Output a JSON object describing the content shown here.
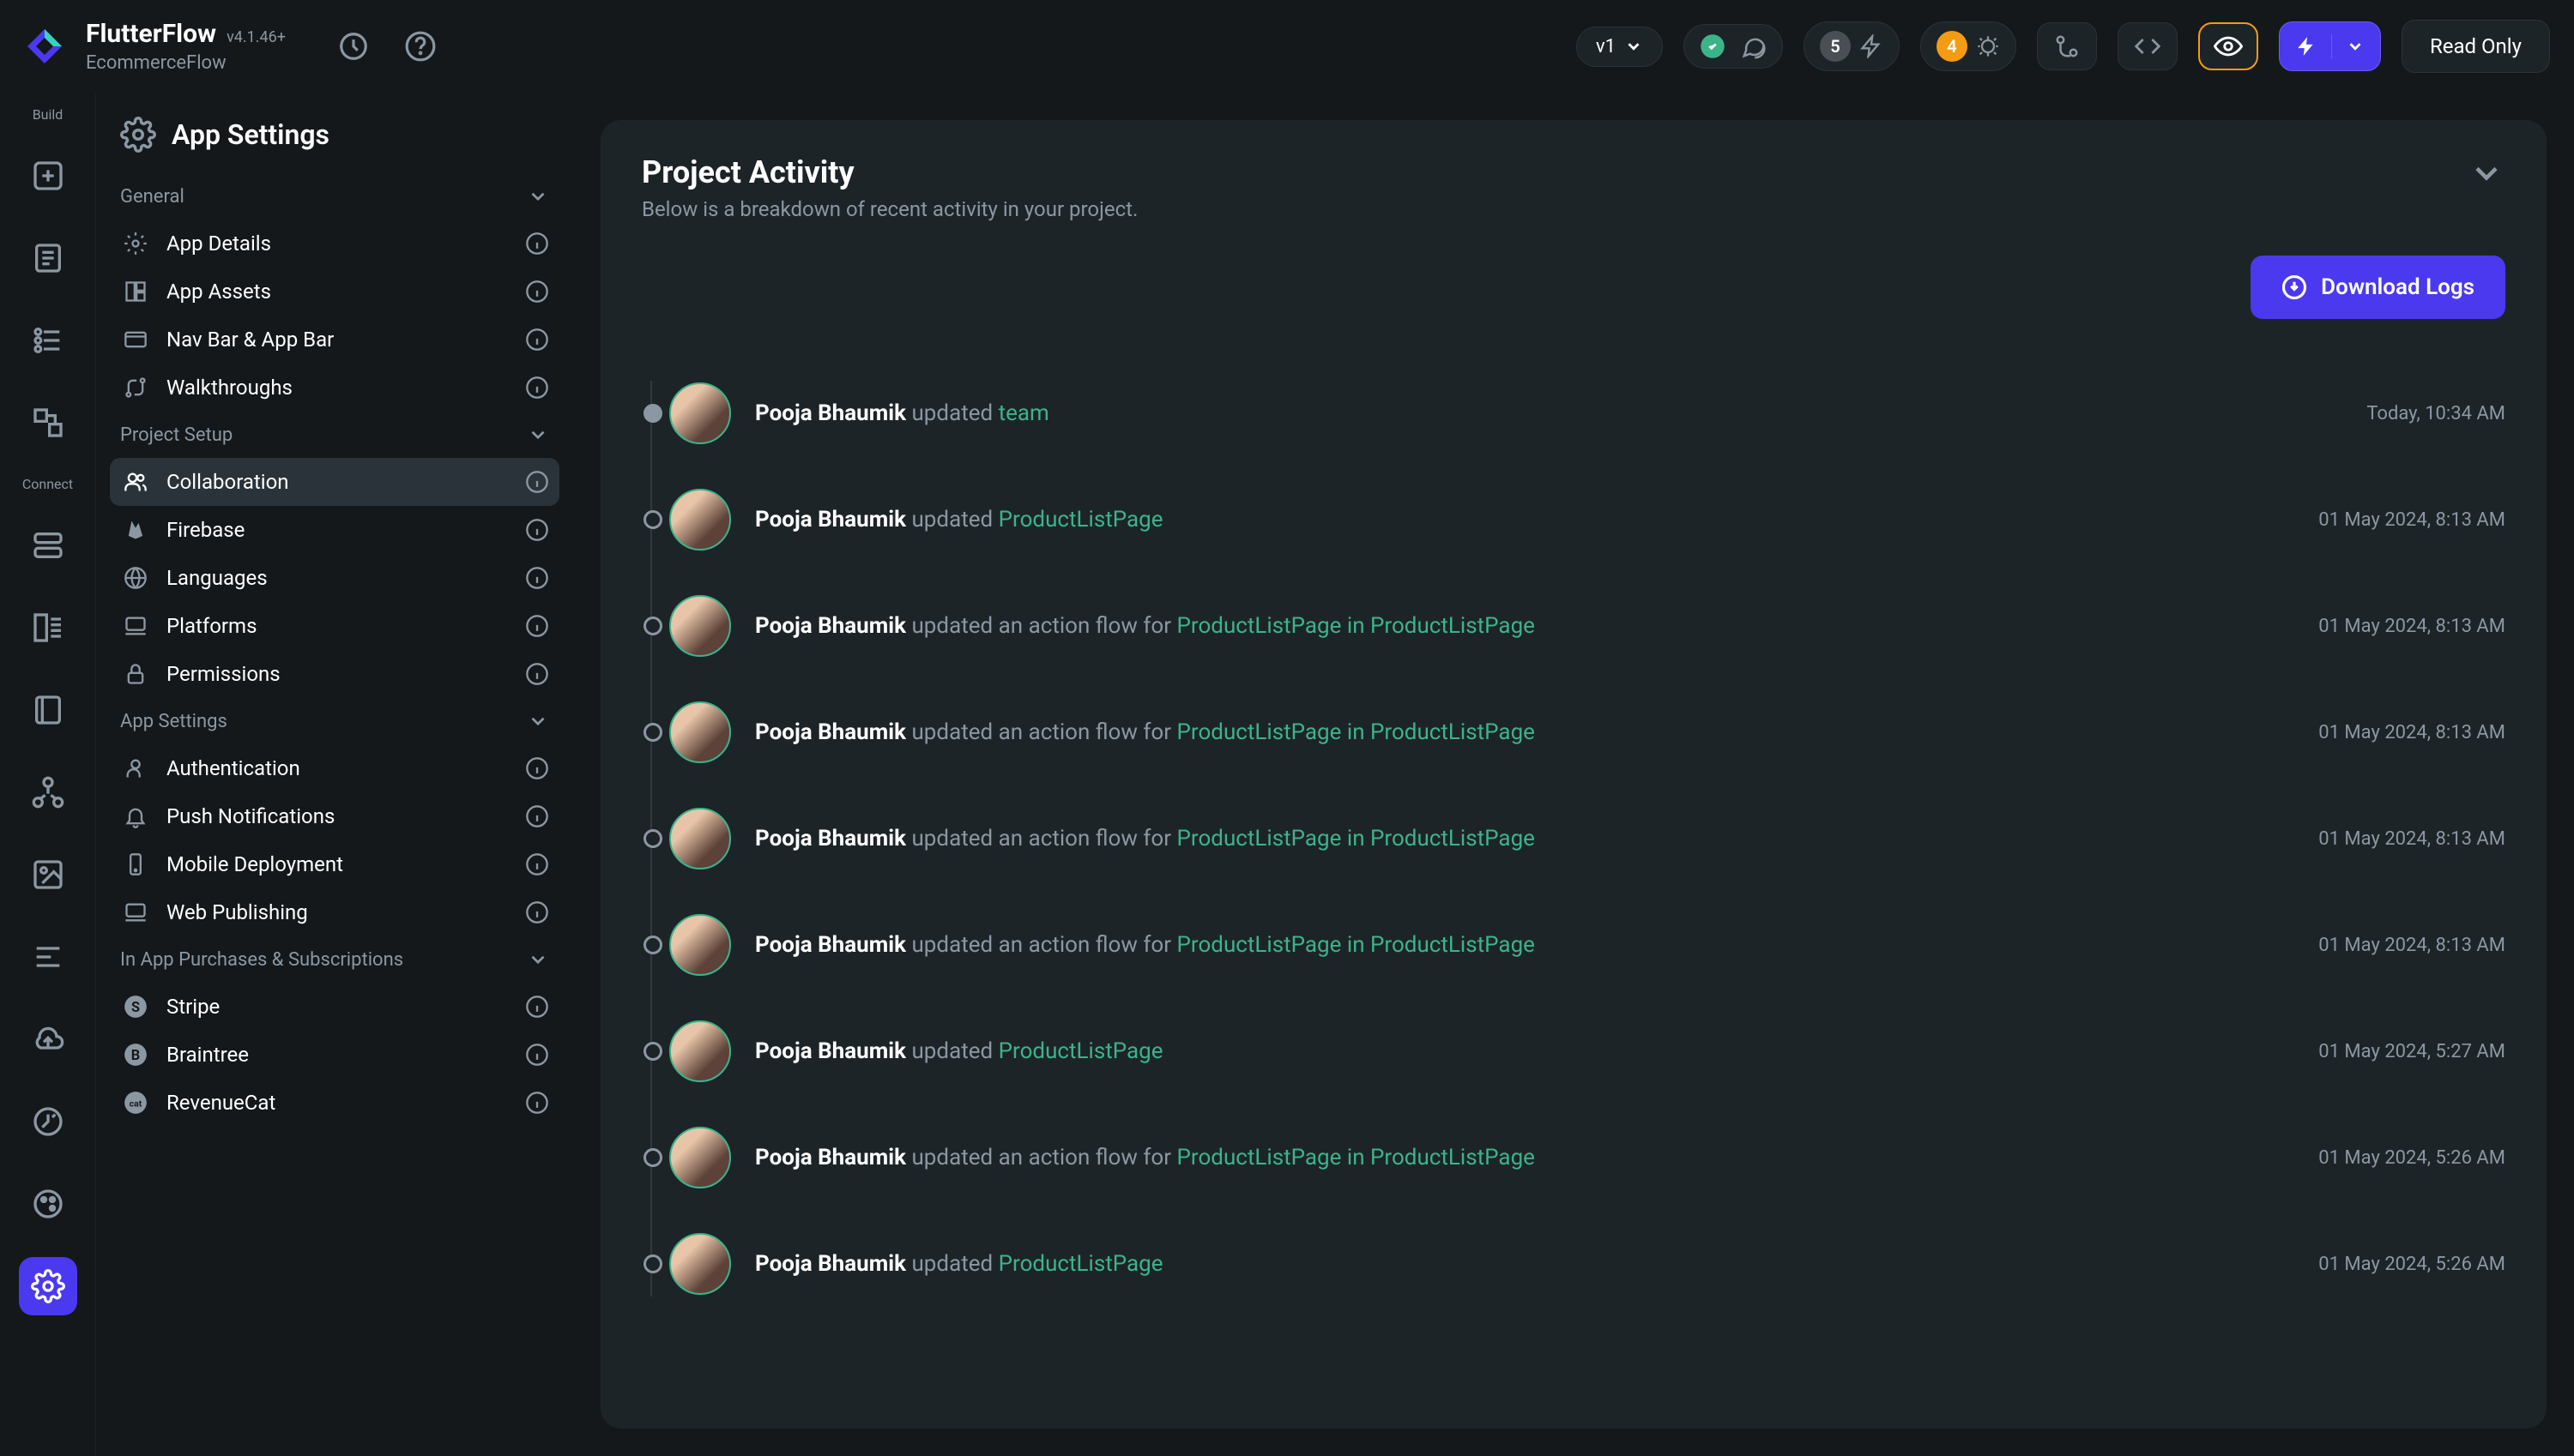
{
  "header": {
    "appTitle": "FlutterFlow",
    "version": "v4.1.46+",
    "projectName": "EcommerceFlow",
    "versionSelector": "v1",
    "warningsCount": "5",
    "bugsCount": "4",
    "readOnly": "Read Only"
  },
  "rail": {
    "buildLabel": "Build",
    "connectLabel": "Connect"
  },
  "sidebar": {
    "title": "App Settings",
    "sections": [
      {
        "label": "General",
        "items": [
          {
            "icon": "gear-outline-icon",
            "label": "App Details"
          },
          {
            "icon": "assets-icon",
            "label": "App Assets"
          },
          {
            "icon": "navbar-icon",
            "label": "Nav Bar & App Bar"
          },
          {
            "icon": "route-icon",
            "label": "Walkthroughs"
          }
        ]
      },
      {
        "label": "Project Setup",
        "items": [
          {
            "icon": "people-icon",
            "label": "Collaboration",
            "active": true
          },
          {
            "icon": "firebase-icon",
            "label": "Firebase"
          },
          {
            "icon": "globe-icon",
            "label": "Languages"
          },
          {
            "icon": "laptop-icon",
            "label": "Platforms"
          },
          {
            "icon": "lock-icon",
            "label": "Permissions"
          }
        ]
      },
      {
        "label": "App Settings",
        "items": [
          {
            "icon": "user-icon",
            "label": "Authentication"
          },
          {
            "icon": "bell-icon",
            "label": "Push Notifications"
          },
          {
            "icon": "mobile-icon",
            "label": "Mobile Deployment"
          },
          {
            "icon": "laptop-icon",
            "label": "Web Publishing"
          }
        ]
      },
      {
        "label": "In App Purchases & Subscriptions",
        "items": [
          {
            "icon": "stripe-icon",
            "label": "Stripe"
          },
          {
            "icon": "braintree-icon",
            "label": "Braintree"
          },
          {
            "icon": "revenuecat-icon",
            "label": "RevenueCat"
          }
        ]
      }
    ]
  },
  "panel": {
    "title": "Project Activity",
    "subtitle": "Below is a breakdown of recent activity in your project.",
    "downloadLabel": "Download Logs"
  },
  "activity": [
    {
      "user": "Pooja Bhaumik",
      "verb": "updated",
      "link": "team",
      "time": "Today, 10:34 AM"
    },
    {
      "user": "Pooja Bhaumik",
      "verb": "updated",
      "link": "ProductListPage",
      "time": "01 May 2024, 8:13 AM"
    },
    {
      "user": "Pooja Bhaumik",
      "verb": "updated an action flow for",
      "link": "ProductListPage in ProductListPage",
      "time": "01 May 2024, 8:13 AM"
    },
    {
      "user": "Pooja Bhaumik",
      "verb": "updated an action flow for",
      "link": "ProductListPage in ProductListPage",
      "time": "01 May 2024, 8:13 AM"
    },
    {
      "user": "Pooja Bhaumik",
      "verb": "updated an action flow for",
      "link": "ProductListPage in ProductListPage",
      "time": "01 May 2024, 8:13 AM"
    },
    {
      "user": "Pooja Bhaumik",
      "verb": "updated an action flow for",
      "link": "ProductListPage in ProductListPage",
      "time": "01 May 2024, 8:13 AM"
    },
    {
      "user": "Pooja Bhaumik",
      "verb": "updated",
      "link": "ProductListPage",
      "time": "01 May 2024, 5:27 AM"
    },
    {
      "user": "Pooja Bhaumik",
      "verb": "updated an action flow for",
      "link": "ProductListPage in ProductListPage",
      "time": "01 May 2024, 5:26 AM"
    },
    {
      "user": "Pooja Bhaumik",
      "verb": "updated",
      "link": "ProductListPage",
      "time": "01 May 2024, 5:26 AM"
    }
  ]
}
